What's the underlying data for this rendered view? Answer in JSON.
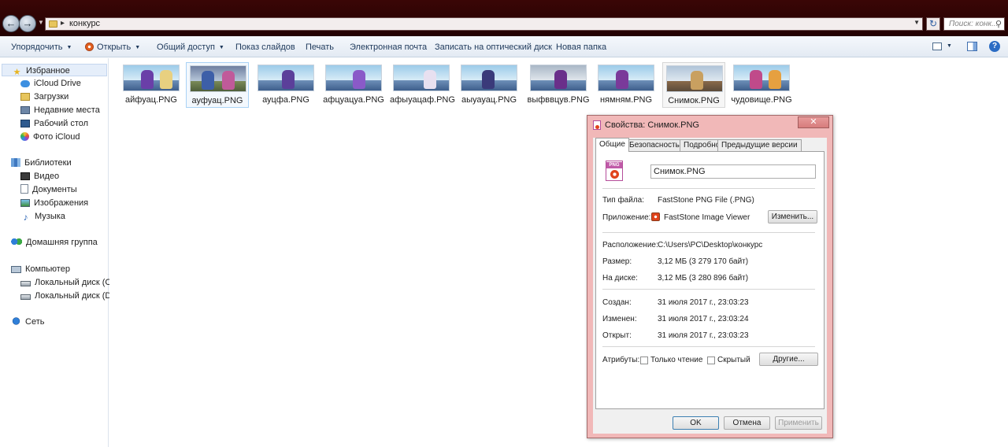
{
  "address": {
    "path": "конкурс",
    "search_placeholder": "Поиск: конк..."
  },
  "toolbar": {
    "organize": "Упорядочить",
    "open": "Открыть",
    "share": "Общий доступ",
    "slideshow": "Показ слайдов",
    "print": "Печать",
    "email": "Электронная почта",
    "burn": "Записать на оптический диск",
    "new_folder": "Новая папка"
  },
  "sidebar": {
    "favorites": {
      "label": "Избранное",
      "items": [
        "iCloud Drive",
        "Загрузки",
        "Недавние места",
        "Рабочий стол",
        "Фото iCloud"
      ]
    },
    "libraries": {
      "label": "Библиотеки",
      "items": [
        "Видео",
        "Документы",
        "Изображения",
        "Музыка"
      ]
    },
    "homegroup": "Домашняя группа",
    "computer": {
      "label": "Компьютер",
      "items": [
        "Локальный диск (C:)",
        "Локальный диск (D:)"
      ]
    },
    "network": "Сеть"
  },
  "files": [
    {
      "name": "айфуац.PNG"
    },
    {
      "name": "ауфуац.PNG"
    },
    {
      "name": "ауцфа.PNG"
    },
    {
      "name": "афцуацуа.PNG"
    },
    {
      "name": "афыуацаф.PNG"
    },
    {
      "name": "аыуауац.PNG"
    },
    {
      "name": "выфввцув.PNG"
    },
    {
      "name": "нямням.PNG"
    },
    {
      "name": "Снимок.PNG"
    },
    {
      "name": "чудовище.PNG"
    }
  ],
  "dialog": {
    "title": "Свойства: Снимок.PNG",
    "close": "✕",
    "tabs": [
      "Общие",
      "Безопасность",
      "Подробно",
      "Предыдущие версии"
    ],
    "icon_label": "PNG",
    "filename": "Снимок.PNG",
    "file_type_label": "Тип файла:",
    "file_type": "FastStone PNG File (.PNG)",
    "app_label": "Приложение:",
    "app": "FastStone Image Viewer",
    "change_button": "Изменить...",
    "location_label": "Расположение:",
    "location": "C:\\Users\\PC\\Desktop\\конкурс",
    "size_label": "Размер:",
    "size": "3,12 МБ (3 279 170 байт)",
    "disk_label": "На диске:",
    "disk": "3,12 МБ (3 280 896 байт)",
    "created_label": "Создан:",
    "created": "31 июля 2017 г., 23:03:23",
    "modified_label": "Изменен:",
    "modified": "31 июля 2017 г., 23:03:24",
    "accessed_label": "Открыт:",
    "accessed": "31 июля 2017 г., 23:03:23",
    "attributes_label": "Атрибуты:",
    "readonly_label": "Только чтение",
    "hidden_label": "Скрытый",
    "other_button": "Другие...",
    "ok": "OK",
    "cancel": "Отмена",
    "apply": "Применить"
  },
  "colors": {
    "titlebar": "#2b0303",
    "dialog_frame": "#f1b8b8",
    "cmdbar_text": "#1e395b"
  }
}
